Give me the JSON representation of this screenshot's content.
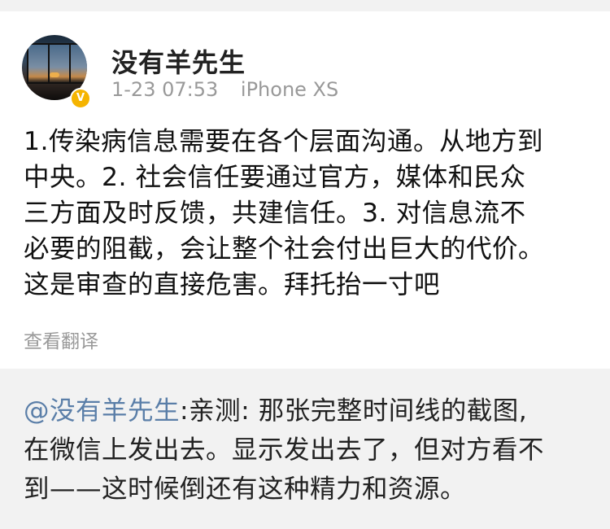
{
  "post": {
    "author": "没有羊先生",
    "verified_badge": "V",
    "timestamp": "1-23 07:53",
    "device": "iPhone XS",
    "content_lines": [
      "1.传染病信息需要在各个层面沟通。从地方到",
      "中央。2. 社会信任要通过官方，媒体和民众",
      "三方面及时反馈，共建信任。3. 对信息流不",
      "必要的阻截，会让整个社会付出巨大的代价。",
      "这是审查的直接危害。拜托抬一寸吧"
    ],
    "translate_label": "查看翻译"
  },
  "repost": {
    "mention": "@没有羊先生",
    "line1_rest": ":亲测: 那张完整时间线的截图,",
    "line2": "在微信上发出去。显示发出去了，但对方看不",
    "line3": "到——这时候倒还有这种精力和资源。"
  },
  "colors": {
    "mention": "#5a7ea8",
    "meta_gray": "#999999",
    "repost_bg": "#f2f2f2",
    "badge": "#f5b400"
  }
}
